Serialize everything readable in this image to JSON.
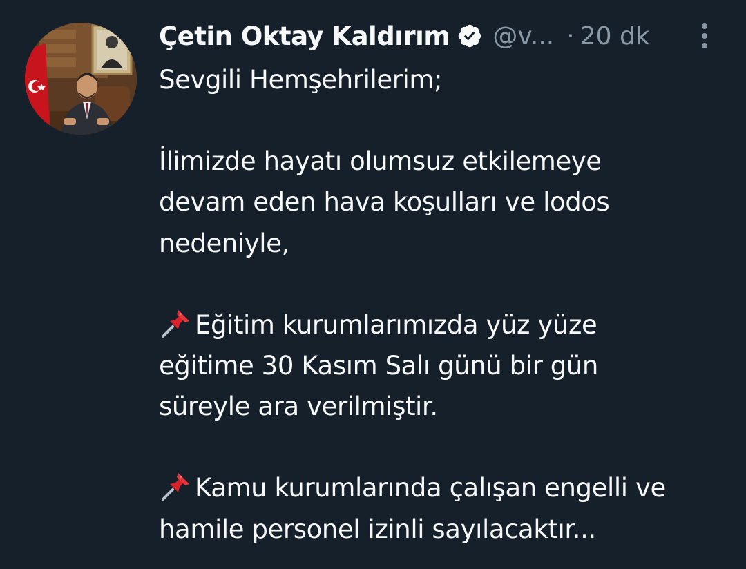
{
  "author": {
    "display_name": "Çetin Oktay Kaldırım",
    "handle": "@v...",
    "separator": "·",
    "timestamp": "20 dk",
    "verified": true,
    "verified_icon": "verified-badge-icon"
  },
  "tweet": {
    "greeting": "Sevgili Hemşehrilerim;",
    "paragraph_1": [
      "İlimizde hayatı olumsuz etkilemeye",
      "devam eden hava koşulları ve lodos",
      "nedeniyle,"
    ],
    "paragraph_2": [
      "Eğitim kurumlarımızda yüz yüze",
      "eğitime 30 Kasım Salı günü bir gün",
      "süreyle ara verilmiştir."
    ],
    "paragraph_3": [
      "Kamu kurumlarında çalışan engelli ve",
      "hamile personel izinli sayılacaktır..."
    ],
    "bullet_icon": "pushpin-icon"
  },
  "colors": {
    "background": "#15202b",
    "text_primary": "#f7f9f9",
    "text_secondary": "#8b98a5",
    "verified_badge": "#f7f9f9"
  }
}
